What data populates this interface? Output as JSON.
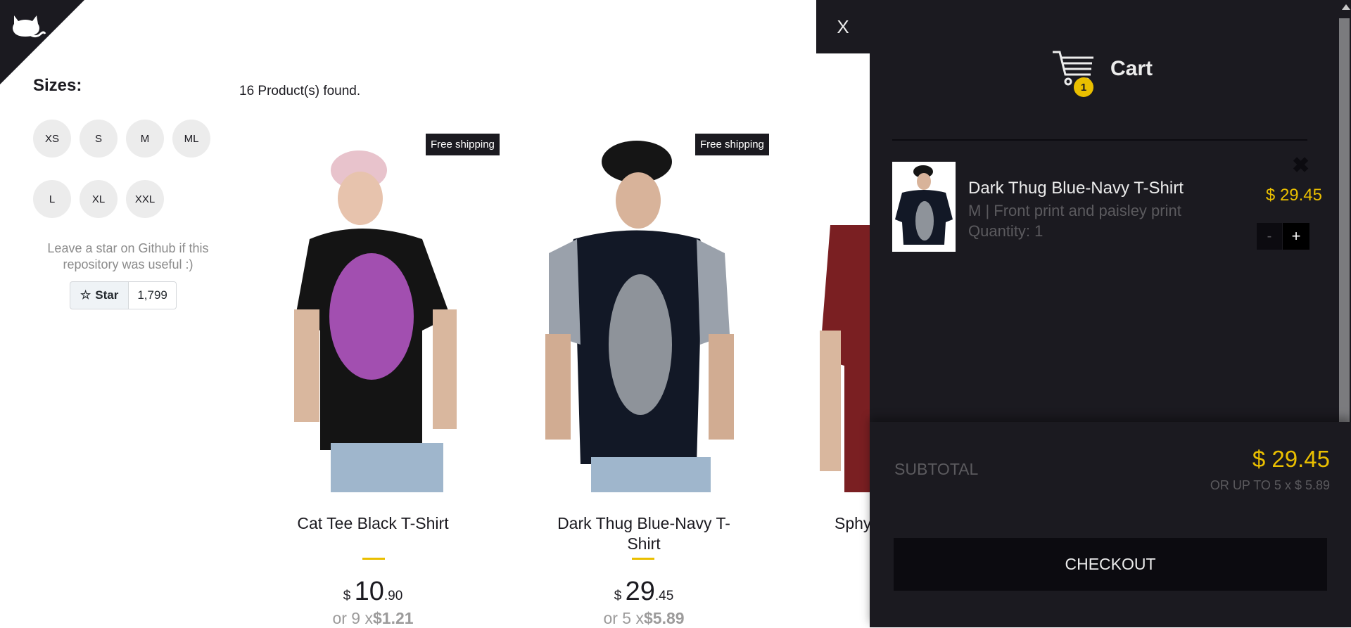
{
  "sizes": {
    "title": "Sizes:",
    "options": [
      "XS",
      "S",
      "M",
      "ML",
      "L",
      "XL",
      "XXL"
    ]
  },
  "github": {
    "note": "Leave a star on Github if this repository was useful :)",
    "star_label": "Star",
    "star_count": "1,799"
  },
  "products_found": "16 Product(s) found.",
  "products": [
    {
      "title": "Cat Tee Black T-Shirt",
      "currency": "$",
      "price_int": "10",
      "price_dec": ".90",
      "inst_prefix": "or 9 x",
      "inst_value": "$1.21",
      "shipping": "Free shipping"
    },
    {
      "title": "Dark Thug Blue-Navy T-Shirt",
      "currency": "$",
      "price_int": "29",
      "price_dec": ".45",
      "inst_prefix": "or 5 x",
      "inst_value": "$5.89",
      "shipping": "Free shipping"
    },
    {
      "title": "Sphy"
    }
  ],
  "close_label": "X",
  "cart": {
    "title": "Cart",
    "count": "1",
    "item": {
      "title": "Dark Thug Blue-Navy T-Shirt",
      "desc": "M | Front print and paisley print",
      "quantity": "Quantity: 1",
      "price": "$ 29.45",
      "minus": "-",
      "plus": "+"
    },
    "subtotal_label": "SUBTOTAL",
    "subtotal_price": "$ 29.45",
    "subtotal_installment": "OR UP TO 5 x $ 5.89",
    "checkout_label": "CHECKOUT"
  },
  "colors": {
    "accent": "#eabf00",
    "dark": "#1b1a20"
  }
}
